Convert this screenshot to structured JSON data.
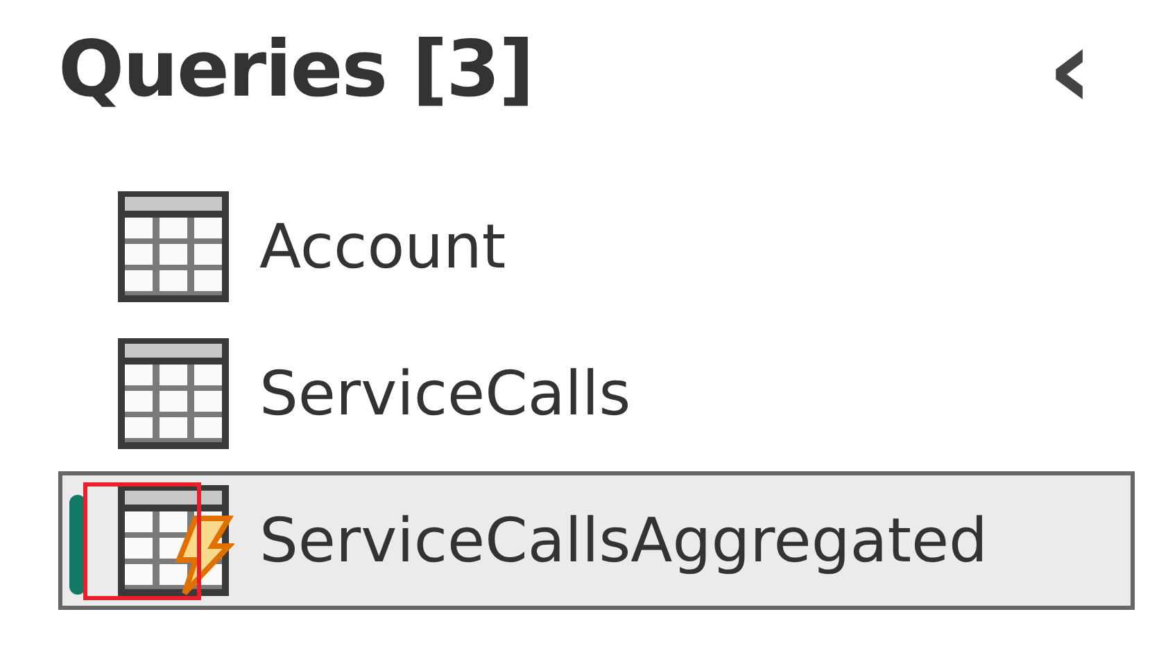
{
  "panel": {
    "title": "Queries [3]",
    "collapse_icon": "‹"
  },
  "queries": [
    {
      "name": "Account",
      "kind": "table",
      "selected": false,
      "highlighted": false
    },
    {
      "name": "ServiceCalls",
      "kind": "table",
      "selected": false,
      "highlighted": false
    },
    {
      "name": "ServiceCallsAggregated",
      "kind": "table_lightning",
      "selected": true,
      "highlighted": true
    }
  ]
}
